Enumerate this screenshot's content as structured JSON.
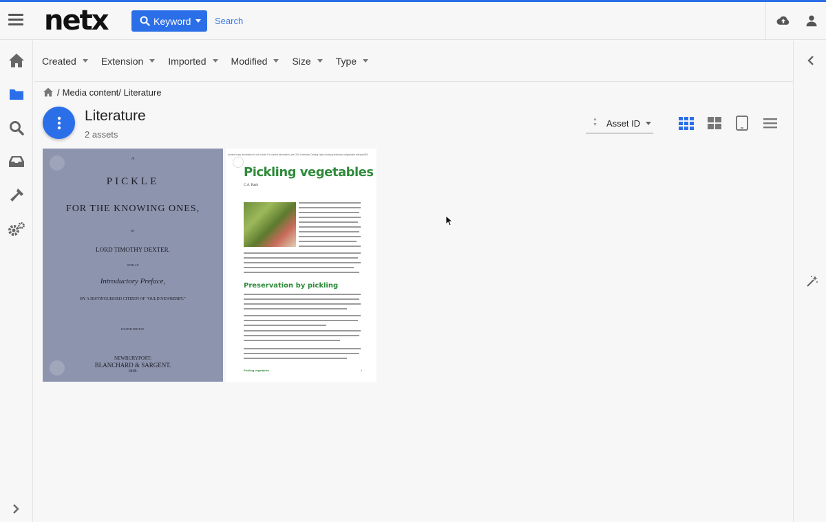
{
  "app": {
    "logo": "netx"
  },
  "header": {
    "keyword_label": "Keyword",
    "search_placeholder": "Search",
    "accent_color": "#2b6fe8"
  },
  "filters": [
    "Created",
    "Extension",
    "Imported",
    "Modified",
    "Size",
    "Type"
  ],
  "breadcrumb": {
    "separator": "/",
    "path": "Media content/ Literature"
  },
  "folder": {
    "title": "Literature",
    "count": "2 assets"
  },
  "sort": {
    "label": "Asset ID"
  },
  "nav_icons": [
    "home-icon",
    "folder-icon",
    "search-icon",
    "inbox-icon",
    "hammer-icon",
    "settings-icon"
  ],
  "view_modes": [
    "grid-small-icon",
    "grid-large-icon",
    "tablet-icon",
    "list-icon"
  ],
  "assets": [
    {
      "lines": [
        "A",
        "PICKLE",
        "FOR THE KNOWING ONES,",
        "BY",
        "LORD TIMOTHY DEXTER.",
        "WITH AN",
        "Introductory Preface,",
        "BY A DISTINGUISHED CITIZEN OF \"OULD NEWBERRY.\"",
        "FOURTH EDITION.",
        "NEWBURYPORT:",
        "BLANCHARD & SARGENT.",
        "1848."
      ]
    },
    {
      "header_note": "Archival copy: information is out of date. For current information, see OSU Extension Catalog: https://catalog.extension.oregonstate.edu/pnw355",
      "title": "Pickling vegetables",
      "author": "C.A. Raab",
      "subheading": "Preservation by pickling",
      "footer": "Pickling vegetables",
      "page": "1"
    }
  ]
}
